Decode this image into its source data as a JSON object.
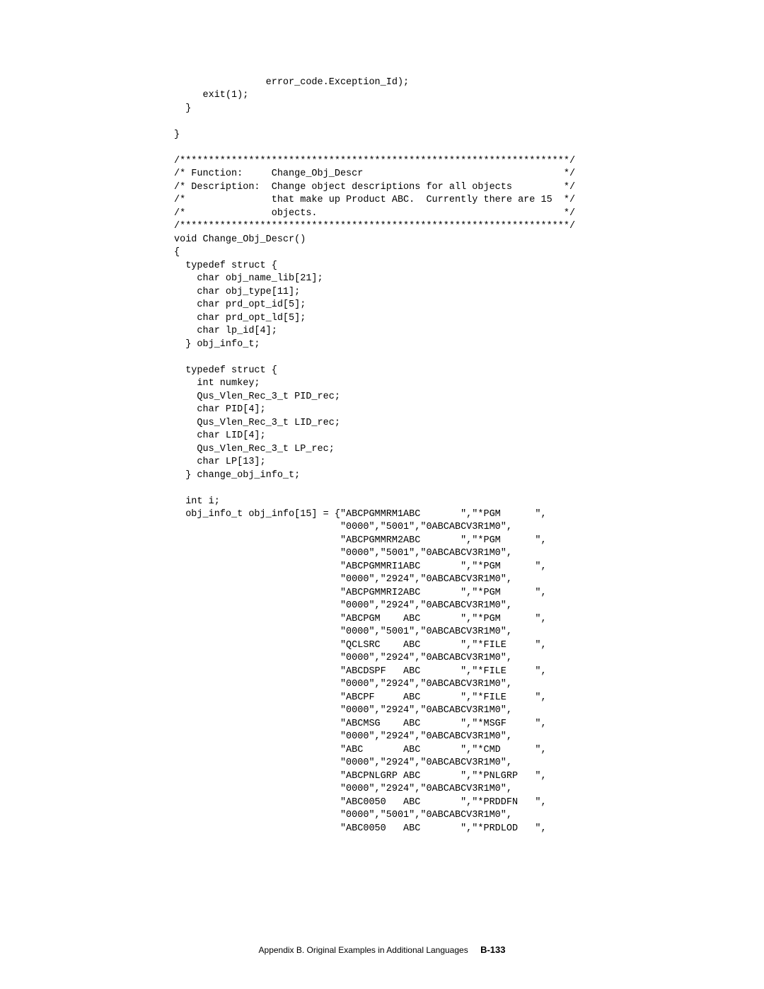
{
  "code_lines": [
    "                error_code.Exception_Id);",
    "     exit(1);",
    "  }",
    "",
    "}",
    "",
    "/********************************************************************/",
    "/* Function:     Change_Obj_Descr                                   */",
    "/* Description:  Change object descriptions for all objects         */",
    "/*               that make up Product ABC.  Currently there are 15  */",
    "/*               objects.                                           */",
    "/********************************************************************/",
    "void Change_Obj_Descr()",
    "{",
    "  typedef struct {",
    "    char obj_name_lib[21];",
    "    char obj_type[11];",
    "    char prd_opt_id[5];",
    "    char prd_opt_ld[5];",
    "    char lp_id[4];",
    "  } obj_info_t;",
    "",
    "  typedef struct {",
    "    int numkey;",
    "    Qus_Vlen_Rec_3_t PID_rec;",
    "    char PID[4];",
    "    Qus_Vlen_Rec_3_t LID_rec;",
    "    char LID[4];",
    "    Qus_Vlen_Rec_3_t LP_rec;",
    "    char LP[13];",
    "  } change_obj_info_t;",
    "",
    "  int i;",
    "  obj_info_t obj_info[15] = {\"ABCPGMMRM1ABC       \",\"*PGM      \",",
    "                             \"0000\",\"5001\",\"0ABCABCV3R1M0\",",
    "                             \"ABCPGMMRM2ABC       \",\"*PGM      \",",
    "                             \"0000\",\"5001\",\"0ABCABCV3R1M0\",",
    "                             \"ABCPGMMRI1ABC       \",\"*PGM      \",",
    "                             \"0000\",\"2924\",\"0ABCABCV3R1M0\",",
    "                             \"ABCPGMMRI2ABC       \",\"*PGM      \",",
    "                             \"0000\",\"2924\",\"0ABCABCV3R1M0\",",
    "                             \"ABCPGM    ABC       \",\"*PGM      \",",
    "                             \"0000\",\"5001\",\"0ABCABCV3R1M0\",",
    "                             \"QCLSRC    ABC       \",\"*FILE     \",",
    "                             \"0000\",\"2924\",\"0ABCABCV3R1M0\",",
    "                             \"ABCDSPF   ABC       \",\"*FILE     \",",
    "                             \"0000\",\"2924\",\"0ABCABCV3R1M0\",",
    "                             \"ABCPF     ABC       \",\"*FILE     \",",
    "                             \"0000\",\"2924\",\"0ABCABCV3R1M0\",",
    "                             \"ABCMSG    ABC       \",\"*MSGF     \",",
    "                             \"0000\",\"2924\",\"0ABCABCV3R1M0\",",
    "                             \"ABC       ABC       \",\"*CMD      \",",
    "                             \"0000\",\"2924\",\"0ABCABCV3R1M0\",",
    "                             \"ABCPNLGRP ABC       \",\"*PNLGRP   \",",
    "                             \"0000\",\"2924\",\"0ABCABCV3R1M0\",",
    "                             \"ABC0050   ABC       \",\"*PRDDFN   \",",
    "                             \"0000\",\"5001\",\"0ABCABCV3R1M0\",",
    "                             \"ABC0050   ABC       \",\"*PRDLOD   \","
  ],
  "footer": {
    "text": "Appendix B. Original Examples in Additional Languages",
    "page_number": "B-133"
  }
}
